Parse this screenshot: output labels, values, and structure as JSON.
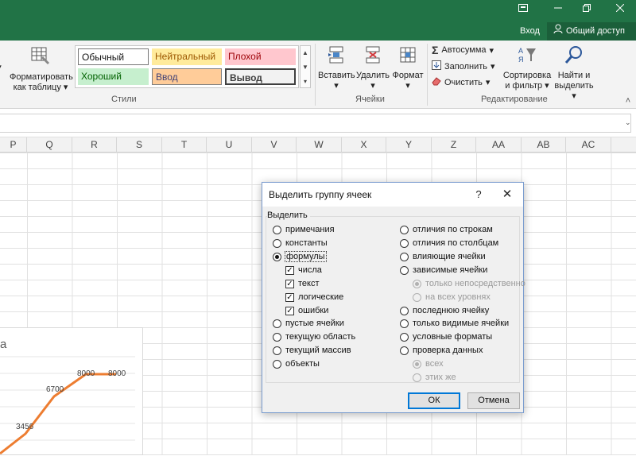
{
  "window": {
    "login": "Вход",
    "share": "Общий доступ",
    "controls": [
      "ribbon-display-icon",
      "restore-icon",
      "close-icon"
    ]
  },
  "ribbon": {
    "format_table": {
      "line1": "Форматировать",
      "line2": "как таблицу"
    },
    "styles": {
      "normal": "Обычный",
      "neutral": "Нейтральный",
      "bad": "Плохой",
      "good": "Хороший",
      "input": "Ввод",
      "output": "Вывод",
      "group_label": "Стили"
    },
    "cells": {
      "insert": "Вставить",
      "delete": "Удалить",
      "format": "Формат",
      "group_label": "Ячейки"
    },
    "editing": {
      "autosum": "Автосумма",
      "fill": "Заполнить",
      "clear": "Очистить",
      "sort_line1": "Сортировка",
      "sort_line2": "и фильтр",
      "find_line1": "Найти и",
      "find_line2": "выделить",
      "group_label": "Редактирование"
    },
    "colors": {
      "green": "#217346",
      "good_bg": "#c6efce",
      "good_fg": "#006100",
      "bad_bg": "#ffc7ce",
      "bad_fg": "#9c0006",
      "neutral_bg": "#ffeb9c",
      "neutral_fg": "#9c5700",
      "input_bg": "#ffcc99",
      "input_fg": "#3f3f76"
    }
  },
  "columns": [
    "P",
    "Q",
    "R",
    "S",
    "T",
    "U",
    "V",
    "W",
    "X",
    "Y",
    "Z",
    "AA",
    "AB",
    "AC"
  ],
  "chart": {
    "title_fragment": "а",
    "labels": [
      "3456",
      "6700",
      "8000",
      "8000"
    ],
    "line_color": "#ed7d31"
  },
  "dialog": {
    "title": "Выделить группу ячеек",
    "help": "?",
    "close": "✕",
    "group": "Выделить",
    "left_options": {
      "notes": "примечания",
      "constants": "константы",
      "formulas": "формулы",
      "numbers": "числа",
      "text": "текст",
      "logicals": "логические",
      "errors": "ошибки",
      "blanks": "пустые ячейки",
      "current_region": "текущую область",
      "current_array": "текущий массив",
      "objects": "объекты"
    },
    "right_options": {
      "row_diff": "отличия по строкам",
      "col_diff": "отличия по столбцам",
      "precedents": "влияющие ячейки",
      "dependents": "зависимые ячейки",
      "direct_only": "только непосредственно",
      "all_levels": "на всех уровнях",
      "last_cell": "последнюю ячейку",
      "visible_only": "только видимые ячейки",
      "cond_formats": "условные форматы",
      "data_validation": "проверка данных",
      "all": "всех",
      "same": "этих же"
    },
    "selected": "формулы",
    "checked": [
      "числа",
      "текст",
      "логические",
      "ошибки"
    ],
    "ok": "ОК",
    "cancel": "Отмена"
  }
}
